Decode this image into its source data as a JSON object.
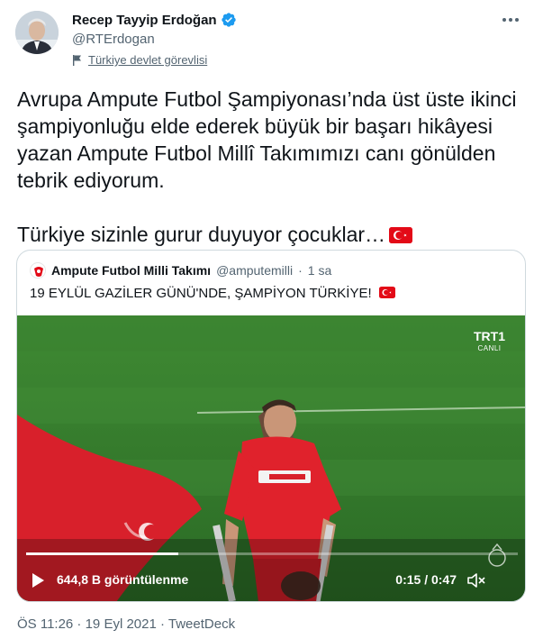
{
  "user": {
    "display_name": "Recep Tayyip Erdoğan",
    "handle": "@RTErdogan",
    "label": "Türkiye devlet görevlisi",
    "verified_icon": "verified-badge-icon",
    "avatar": "avatar"
  },
  "tweet": {
    "paragraph1": "Avrupa Ampute Futbol Şampiyonası’nda üst üste ikinci şampiyonluğu elde ederek büyük bir başarı hikâyesi yazan Ampute Futbol Millî Takımımızı canı gönülden tebrik ediyorum.",
    "paragraph2": "Türkiye sizinle gurur duyuyor çocuklar…",
    "emoji": "turkey-flag"
  },
  "quote": {
    "name": "Ampute Futbol Milli Takımı",
    "handle": "@amputemilli",
    "separator": "·",
    "age": "1 sa",
    "text": "19 EYLÜL GAZİLER GÜNÜ'NDE,  ŞAMPİYON TÜRKİYE!",
    "emoji": "turkey-flag"
  },
  "video": {
    "channel_logo": "TRT1",
    "channel_sub": "CANLI",
    "views": "644,8 B görüntülenme",
    "time": "0:15 / 0:47",
    "progress": 0.31,
    "play_icon": "play-icon",
    "mute_icon": "mute-icon"
  },
  "footer": {
    "meta": "ÖS 11:26 · 19 Eyl 2021 · TweetDeck"
  },
  "colors": {
    "text_primary": "#0f1419",
    "text_secondary": "#536471",
    "verified_blue": "#1d9bf0",
    "flag_red": "#e30a17",
    "border": "#cfd9de",
    "pitch_green": "#2e7a2a"
  }
}
